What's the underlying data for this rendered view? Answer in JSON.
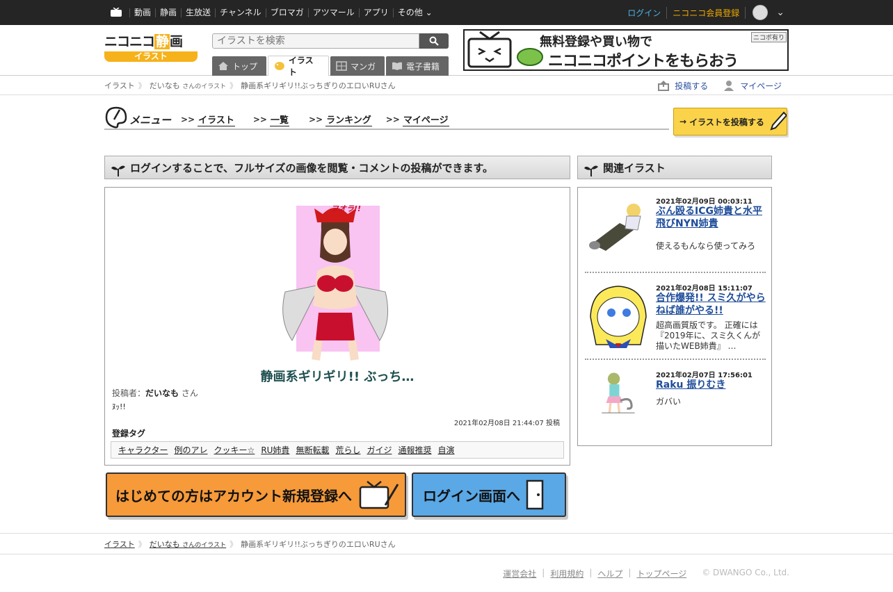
{
  "topnav": {
    "items": [
      "動画",
      "静画",
      "生放送",
      "チャンネル",
      "ブロマガ",
      "アツマール",
      "アプリ",
      "その他"
    ],
    "login": "ログイン",
    "register": "ニコニコ会員登録"
  },
  "header": {
    "logo_main": "ニコニコ",
    "logo_sei": "静",
    "logo_ga": "画",
    "logo_sub": "イラスト",
    "search_placeholder": "イラストを検索",
    "tabs": [
      "トップ",
      "イラスト",
      "マンガ",
      "電子書籍"
    ],
    "banner_line1": "無料登録や買い物で",
    "banner_line2": "ニコニコポイントをもらおう",
    "banner_tag": "ニコポ有り"
  },
  "breadcrumb": {
    "root": "イラスト",
    "user": "だいなも",
    "user_suffix": "さんのイラスト",
    "current": "静画系ギリギリ!!ぶっちぎりのエロいRUさん"
  },
  "actions": {
    "post": "投稿する",
    "mypage": "マイページ"
  },
  "menu": {
    "title": "メニュー",
    "links": [
      "イラスト",
      "一覧",
      "ランキング",
      "マイページ"
    ],
    "post_button": "イラストを投稿する"
  },
  "main": {
    "header": "ログインすることで、フルサイズの画像を閲覧・コメントの投稿ができます。",
    "illust_text": "フオラ!!",
    "title": "静画系ギリギリ!! ぶっち…",
    "poster_label": "投稿者：",
    "poster_name": "だいなも",
    "poster_suffix": "さん",
    "caption": "ﾇｯ!!",
    "date": "2021年02月08日 21:44:07 投稿",
    "tags_heading": "登録タグ",
    "tags": [
      "キャラクター",
      "例のアレ",
      "クッキー☆",
      "RU姉貴",
      "無断転載",
      "荒らし",
      "ガイジ",
      "通報推奨",
      "自演"
    ]
  },
  "buttons": {
    "register": "はじめての方はアカウント新規登録へ",
    "login": "ログイン画面へ"
  },
  "related": {
    "header": "関連イラスト",
    "items": [
      {
        "date": "2021年02月09日 00:03:11",
        "title": "ぶん殴るICG姉貴と水平飛びNYN姉貴",
        "desc": "使えるもんなら使ってみろ"
      },
      {
        "date": "2021年02月08日 15:11:07",
        "title": "合作爆発!! スミ久がやらねば誰がやる!!",
        "desc": "超高画質版です。 正確には『2019年に、スミ久くんが描いたWEB姉貴』 …"
      },
      {
        "date": "2021年02月07日 17:56:01",
        "title": "Raku 振りむき",
        "desc": "ガバい"
      }
    ]
  },
  "footer": {
    "links": [
      "運営会社",
      "利用規約",
      "ヘルプ",
      "トップページ"
    ],
    "copyright": "© DWANGO Co., Ltd."
  }
}
